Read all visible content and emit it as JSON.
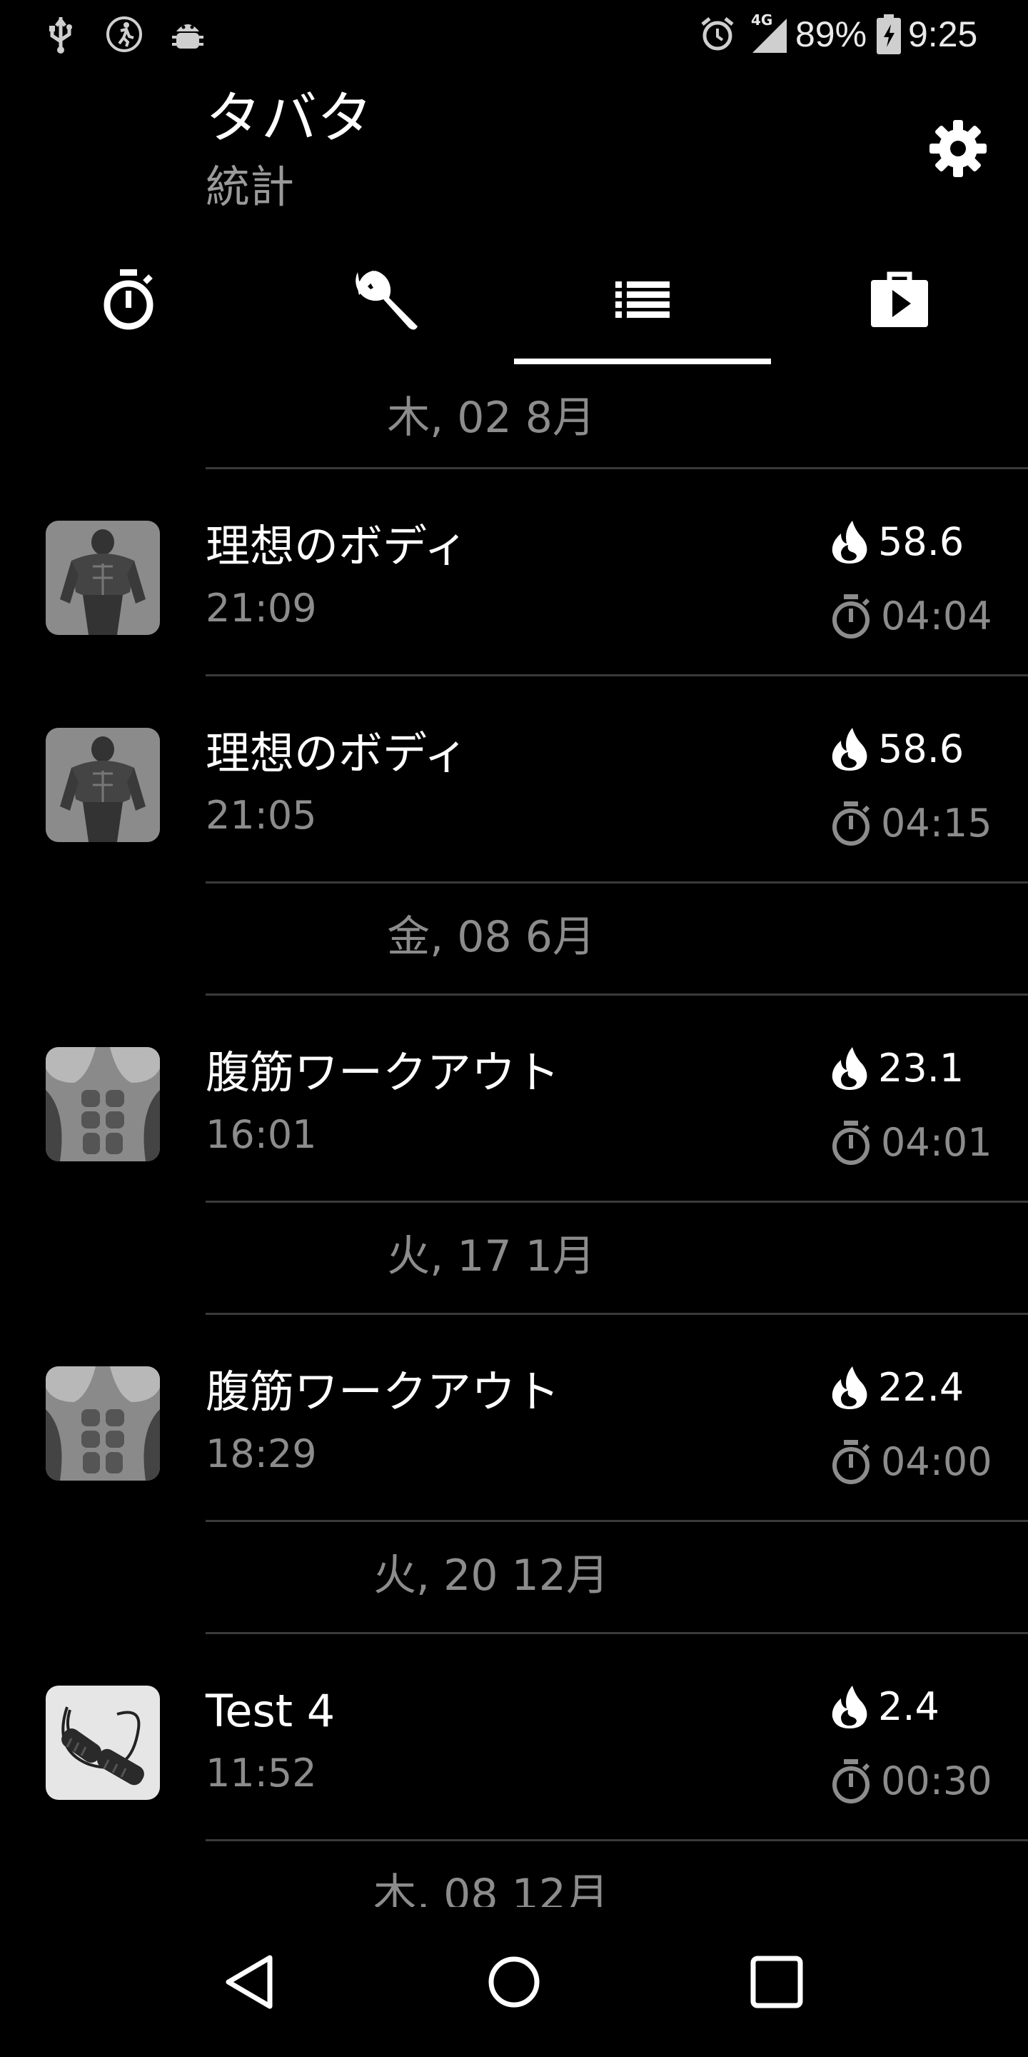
{
  "status_bar": {
    "icons_left": [
      "usb-icon",
      "activity-icon",
      "android-debug-icon"
    ],
    "icons_right": [
      "alarm-icon",
      "signal-icon",
      "battery-icon"
    ],
    "network": "4G",
    "battery": "89%",
    "time": "9:25"
  },
  "header": {
    "title": "タバタ",
    "subtitle": "統計",
    "settings_icon": "gear-icon"
  },
  "tabs": [
    {
      "icon": "timer-icon",
      "selected": false
    },
    {
      "icon": "wrench-icon",
      "selected": false
    },
    {
      "icon": "list-icon",
      "selected": true
    },
    {
      "icon": "play-bag-icon",
      "selected": false
    }
  ],
  "groups": [
    {
      "date": "木, 02 8月",
      "items": [
        {
          "title": "理想のボディ",
          "time": "21:09",
          "calories": "58.6",
          "duration": "04:04",
          "thumb": "body"
        },
        {
          "title": "理想のボディ",
          "time": "21:05",
          "calories": "58.6",
          "duration": "04:15",
          "thumb": "body"
        }
      ]
    },
    {
      "date": "金, 08 6月",
      "items": [
        {
          "title": "腹筋ワークアウト",
          "time": "16:01",
          "calories": "23.1",
          "duration": "04:01",
          "thumb": "abs"
        }
      ]
    },
    {
      "date": "火, 17 1月",
      "items": [
        {
          "title": "腹筋ワークアウト",
          "time": "18:29",
          "calories": "22.4",
          "duration": "04:00",
          "thumb": "abs"
        }
      ]
    },
    {
      "date": "火, 20 12月",
      "items": [
        {
          "title": "Test 4",
          "time": "11:52",
          "calories": "2.4",
          "duration": "00:30",
          "thumb": "rope"
        }
      ]
    },
    {
      "date": "木, 08 12月",
      "items": []
    }
  ],
  "nav_bar": {
    "icons": [
      "back-icon",
      "home-icon",
      "recents-icon"
    ]
  },
  "colors": {
    "background": "#000000",
    "primary_text": "#ffffff",
    "secondary_text": "#8c8c8c",
    "divider": "#3a3a3a"
  }
}
